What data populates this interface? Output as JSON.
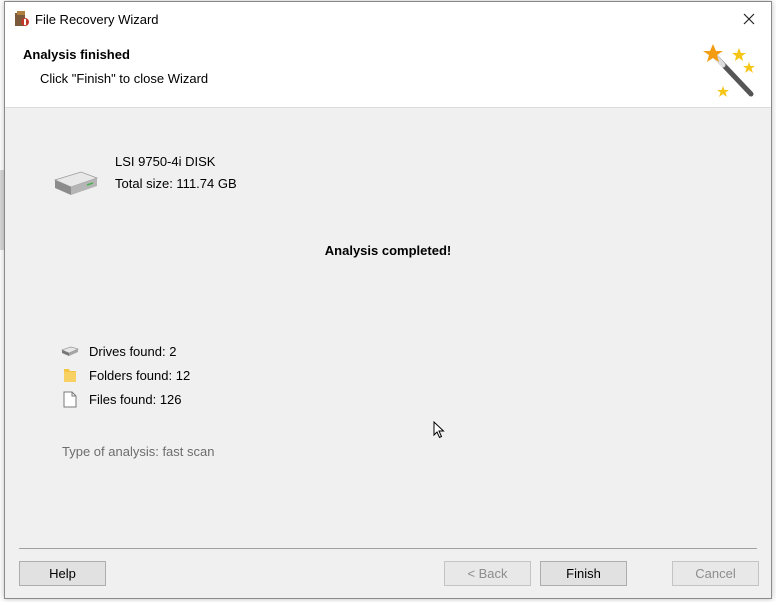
{
  "window": {
    "title": "File Recovery Wizard",
    "close_glyph": "✕"
  },
  "header": {
    "title": "Analysis finished",
    "subtitle": "Click \"Finish\" to close Wizard"
  },
  "disk": {
    "name": "LSI 9750-4i DISK",
    "total_size": "Total size: 111.74 GB",
    "icon": "hard-drive-icon"
  },
  "status": "Analysis completed!",
  "stats": [
    {
      "icon": "drive-icon",
      "label": "Drives found: 2"
    },
    {
      "icon": "folder-icon",
      "label": "Folders found: 12"
    },
    {
      "icon": "file-icon",
      "label": "Files found: 126"
    }
  ],
  "analysis_type": "Type of analysis: fast scan",
  "buttons": {
    "help": "Help",
    "back": "< Back",
    "finish": "Finish",
    "cancel": "Cancel"
  },
  "colors": {
    "dialog_bg": "#f0f0f0",
    "header_bg": "#ffffff",
    "button_bg": "#e1e1e1",
    "disabled_text": "#8d8d8d",
    "folder_yellow": "#f4c542"
  }
}
